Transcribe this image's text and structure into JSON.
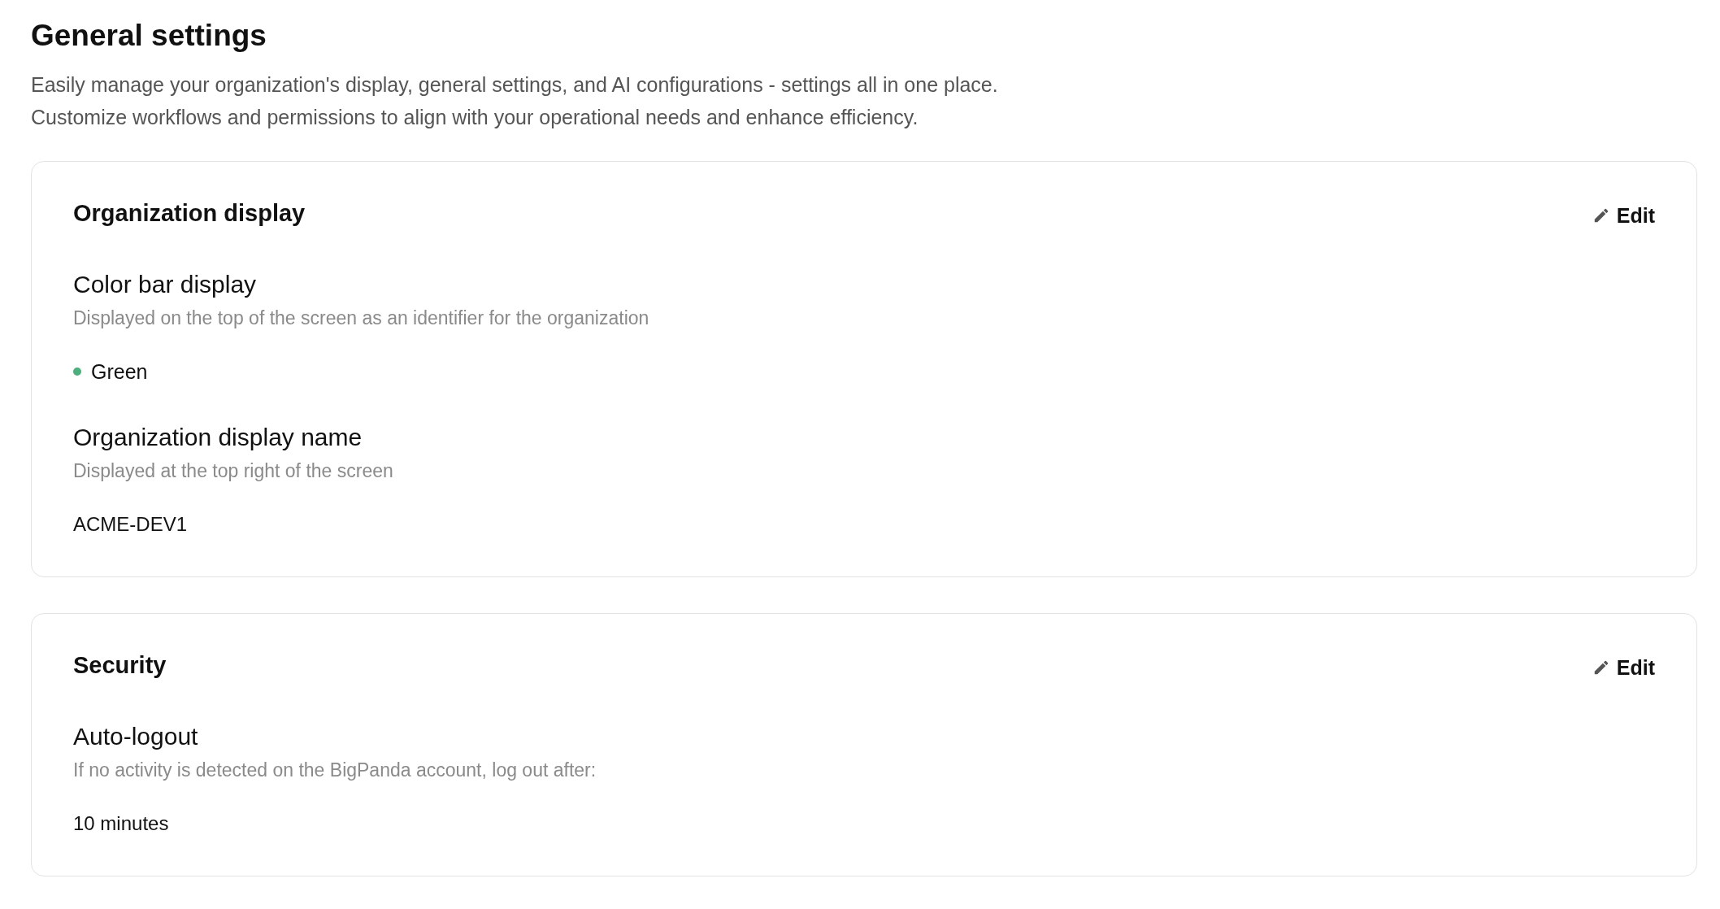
{
  "title": "General settings",
  "description": [
    "Easily manage your organization's display, general settings, and AI configurations - settings all in one place.",
    "Customize workflows and permissions to align with your operational needs and enhance efficiency."
  ],
  "sections": [
    {
      "title": "Organization display",
      "edit_label": "Edit",
      "settings": [
        {
          "name": "Color bar display",
          "description": "Displayed on the top of the screen as an identifier for the organization",
          "kind": "color",
          "value": "Green",
          "color": "#4caf7d"
        },
        {
          "name": "Organization display name",
          "description": "Displayed at the top right of the screen",
          "kind": "text",
          "value": "ACME-DEV1"
        }
      ]
    },
    {
      "title": "Security",
      "edit_label": "Edit",
      "settings": [
        {
          "name": "Auto-logout",
          "description": "If no activity is detected on the BigPanda account, log out after:",
          "kind": "text",
          "value": "10 minutes"
        }
      ]
    }
  ]
}
